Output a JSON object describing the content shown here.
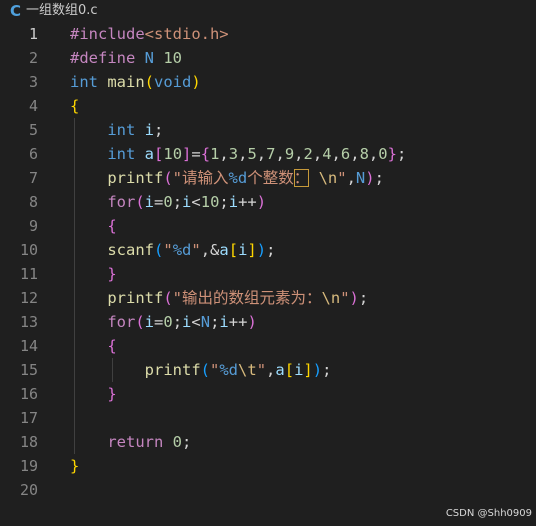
{
  "tab": {
    "icon": "c-language-icon",
    "icon_glyph": "C",
    "filename": "一组数组0.c"
  },
  "lines": [
    {
      "num": "1",
      "indent": 0,
      "tokens": [
        {
          "t": "#include",
          "c": "dir"
        },
        {
          "t": "<stdio.h>",
          "c": "str"
        }
      ]
    },
    {
      "num": "2",
      "indent": 0,
      "tokens": [
        {
          "t": "#define",
          "c": "dir"
        },
        {
          "t": " N ",
          "c": "macro"
        },
        {
          "t": "10",
          "c": "num"
        }
      ]
    },
    {
      "num": "3",
      "indent": 0,
      "tokens": [
        {
          "t": "int",
          "c": "kw"
        },
        {
          "t": " ",
          "c": "plain"
        },
        {
          "t": "main",
          "c": "fn"
        },
        {
          "t": "(",
          "c": "b1"
        },
        {
          "t": "void",
          "c": "kw"
        },
        {
          "t": ")",
          "c": "b1"
        }
      ]
    },
    {
      "num": "4",
      "indent": 0,
      "tokens": [
        {
          "t": "{",
          "c": "b1"
        }
      ]
    },
    {
      "num": "5",
      "indent": 1,
      "tokens": [
        {
          "t": "    int",
          "c": "kw"
        },
        {
          "t": " ",
          "c": "plain"
        },
        {
          "t": "i",
          "c": "var"
        },
        {
          "t": ";",
          "c": "plain"
        }
      ]
    },
    {
      "num": "6",
      "indent": 1,
      "tokens": [
        {
          "t": "    int",
          "c": "kw"
        },
        {
          "t": " ",
          "c": "plain"
        },
        {
          "t": "a",
          "c": "var"
        },
        {
          "t": "[",
          "c": "b2"
        },
        {
          "t": "10",
          "c": "num"
        },
        {
          "t": "]",
          "c": "b2"
        },
        {
          "t": "=",
          "c": "plain"
        },
        {
          "t": "{",
          "c": "b2"
        },
        {
          "t": "1",
          "c": "num"
        },
        {
          "t": ",",
          "c": "plain"
        },
        {
          "t": "3",
          "c": "num"
        },
        {
          "t": ",",
          "c": "plain"
        },
        {
          "t": "5",
          "c": "num"
        },
        {
          "t": ",",
          "c": "plain"
        },
        {
          "t": "7",
          "c": "num"
        },
        {
          "t": ",",
          "c": "plain"
        },
        {
          "t": "9",
          "c": "num"
        },
        {
          "t": ",",
          "c": "plain"
        },
        {
          "t": "2",
          "c": "num"
        },
        {
          "t": ",",
          "c": "plain"
        },
        {
          "t": "4",
          "c": "num"
        },
        {
          "t": ",",
          "c": "plain"
        },
        {
          "t": "6",
          "c": "num"
        },
        {
          "t": ",",
          "c": "plain"
        },
        {
          "t": "8",
          "c": "num"
        },
        {
          "t": ",",
          "c": "plain"
        },
        {
          "t": "0",
          "c": "num"
        },
        {
          "t": "}",
          "c": "b2"
        },
        {
          "t": ";",
          "c": "plain"
        }
      ]
    },
    {
      "num": "7",
      "indent": 1,
      "tokens": [
        {
          "t": "    printf",
          "c": "fn"
        },
        {
          "t": "(",
          "c": "b2"
        },
        {
          "t": "\"请输入",
          "c": "str"
        },
        {
          "t": "%d",
          "c": "kw"
        },
        {
          "t": "个整数",
          "c": "str"
        },
        {
          "t": "：",
          "c": "str",
          "box": true
        },
        {
          "t": " ",
          "c": "str"
        },
        {
          "t": "\\n",
          "c": "esc"
        },
        {
          "t": "\"",
          "c": "str"
        },
        {
          "t": ",",
          "c": "plain"
        },
        {
          "t": "N",
          "c": "macro"
        },
        {
          "t": ")",
          "c": "b2"
        },
        {
          "t": ";",
          "c": "plain"
        }
      ]
    },
    {
      "num": "8",
      "indent": 1,
      "tokens": [
        {
          "t": "    for",
          "c": "ctrl"
        },
        {
          "t": "(",
          "c": "b2"
        },
        {
          "t": "i",
          "c": "var"
        },
        {
          "t": "=",
          "c": "plain"
        },
        {
          "t": "0",
          "c": "num"
        },
        {
          "t": ";",
          "c": "plain"
        },
        {
          "t": "i",
          "c": "var"
        },
        {
          "t": "<",
          "c": "plain"
        },
        {
          "t": "10",
          "c": "num"
        },
        {
          "t": ";",
          "c": "plain"
        },
        {
          "t": "i",
          "c": "var"
        },
        {
          "t": "++",
          "c": "plain"
        },
        {
          "t": ")",
          "c": "b2"
        }
      ]
    },
    {
      "num": "9",
      "indent": 1,
      "tokens": [
        {
          "t": "    {",
          "c": "b2"
        }
      ]
    },
    {
      "num": "10",
      "indent": 1,
      "tokens": [
        {
          "t": "    scanf",
          "c": "fn"
        },
        {
          "t": "(",
          "c": "b3"
        },
        {
          "t": "\"",
          "c": "str"
        },
        {
          "t": "%d",
          "c": "kw"
        },
        {
          "t": "\"",
          "c": "str"
        },
        {
          "t": ",&",
          "c": "plain"
        },
        {
          "t": "a",
          "c": "var"
        },
        {
          "t": "[",
          "c": "b1"
        },
        {
          "t": "i",
          "c": "var"
        },
        {
          "t": "]",
          "c": "b1"
        },
        {
          "t": ")",
          "c": "b3"
        },
        {
          "t": ";",
          "c": "plain"
        }
      ]
    },
    {
      "num": "11",
      "indent": 1,
      "tokens": [
        {
          "t": "    }",
          "c": "b2"
        }
      ]
    },
    {
      "num": "12",
      "indent": 1,
      "tokens": [
        {
          "t": "    printf",
          "c": "fn"
        },
        {
          "t": "(",
          "c": "b2"
        },
        {
          "t": "\"输出的数组元素为：",
          "c": "str"
        },
        {
          "t": "\\n",
          "c": "esc"
        },
        {
          "t": "\"",
          "c": "str"
        },
        {
          "t": ")",
          "c": "b2"
        },
        {
          "t": ";",
          "c": "plain"
        }
      ]
    },
    {
      "num": "13",
      "indent": 1,
      "tokens": [
        {
          "t": "    for",
          "c": "ctrl"
        },
        {
          "t": "(",
          "c": "b2"
        },
        {
          "t": "i",
          "c": "var"
        },
        {
          "t": "=",
          "c": "plain"
        },
        {
          "t": "0",
          "c": "num"
        },
        {
          "t": ";",
          "c": "plain"
        },
        {
          "t": "i",
          "c": "var"
        },
        {
          "t": "<",
          "c": "plain"
        },
        {
          "t": "N",
          "c": "macro"
        },
        {
          "t": ";",
          "c": "plain"
        },
        {
          "t": "i",
          "c": "var"
        },
        {
          "t": "++",
          "c": "plain"
        },
        {
          "t": ")",
          "c": "b2"
        }
      ]
    },
    {
      "num": "14",
      "indent": 1,
      "tokens": [
        {
          "t": "    {",
          "c": "b2"
        }
      ]
    },
    {
      "num": "15",
      "indent": 2,
      "tokens": [
        {
          "t": "        printf",
          "c": "fn"
        },
        {
          "t": "(",
          "c": "b3"
        },
        {
          "t": "\"",
          "c": "str"
        },
        {
          "t": "%d",
          "c": "kw"
        },
        {
          "t": "\\t",
          "c": "esc"
        },
        {
          "t": "\"",
          "c": "str"
        },
        {
          "t": ",",
          "c": "plain"
        },
        {
          "t": "a",
          "c": "var"
        },
        {
          "t": "[",
          "c": "b1"
        },
        {
          "t": "i",
          "c": "var"
        },
        {
          "t": "]",
          "c": "b1"
        },
        {
          "t": ")",
          "c": "b3"
        },
        {
          "t": ";",
          "c": "plain"
        }
      ]
    },
    {
      "num": "16",
      "indent": 1,
      "tokens": [
        {
          "t": "    }",
          "c": "b2"
        }
      ]
    },
    {
      "num": "17",
      "indent": 1,
      "tokens": []
    },
    {
      "num": "18",
      "indent": 1,
      "tokens": [
        {
          "t": "    return",
          "c": "ctrl"
        },
        {
          "t": " ",
          "c": "plain"
        },
        {
          "t": "0",
          "c": "num"
        },
        {
          "t": ";",
          "c": "plain"
        }
      ]
    },
    {
      "num": "19",
      "indent": 0,
      "tokens": [
        {
          "t": "}",
          "c": "b1"
        }
      ]
    },
    {
      "num": "20",
      "indent": 0,
      "tokens": []
    }
  ],
  "active_line": "1",
  "watermark": "CSDN @Shh0909"
}
